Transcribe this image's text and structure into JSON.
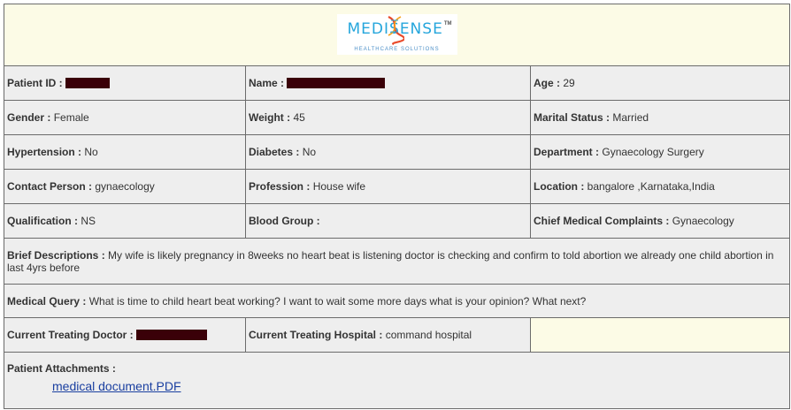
{
  "header": {
    "logo_name": "MEDISENSE",
    "logo_tm": "TM",
    "logo_tagline": "HEALTHCARE SOLUTIONS"
  },
  "row1": {
    "patient_id_label": "Patient ID :",
    "name_label": "Name :",
    "age_label": "Age :",
    "age_value": "29"
  },
  "row2": {
    "gender_label": "Gender :",
    "gender_value": "Female",
    "weight_label": "Weight :",
    "weight_value": "45",
    "marital_label": "Marital Status :",
    "marital_value": "Married"
  },
  "row3": {
    "hypertension_label": "Hypertension :",
    "hypertension_value": "No",
    "diabetes_label": "Diabetes :",
    "diabetes_value": "No",
    "department_label": "Department :",
    "department_value": "Gynaecology Surgery"
  },
  "row4": {
    "contact_label": "Contact Person :",
    "contact_value": "gynaecology",
    "profession_label": "Profession :",
    "profession_value": "House wife",
    "location_label": "Location :",
    "location_value": "bangalore ,Karnataka,India"
  },
  "row5": {
    "qualification_label": "Qualification :",
    "qualification_value": "NS",
    "blood_group_label": "Blood Group :",
    "complaints_label": "Chief Medical Complaints :",
    "complaints_value": "Gynaecology"
  },
  "brief": {
    "label": "Brief Descriptions :",
    "text": "My wife is likely pregnancy in 8weeks no heart beat is listening doctor is checking and confirm to told abortion we already one child abortion in last 4yrs before"
  },
  "query": {
    "label": "Medical Query :",
    "text": "What is time to child heart beat working? I want to wait some more days what is your opinion? What next?"
  },
  "treating": {
    "doctor_label": "Current Treating Doctor :",
    "hospital_label": "Current Treating Hospital :",
    "hospital_value": "command hospital"
  },
  "attachments": {
    "label": "Patient Attachments :",
    "file_link": "medical document.PDF"
  },
  "colors": {
    "header_bg": "#fcfbe6",
    "cell_bg": "#eeeeee",
    "redaction": "#3a0008",
    "logo_blue": "#25a6dc",
    "link": "#1a3fa0"
  }
}
